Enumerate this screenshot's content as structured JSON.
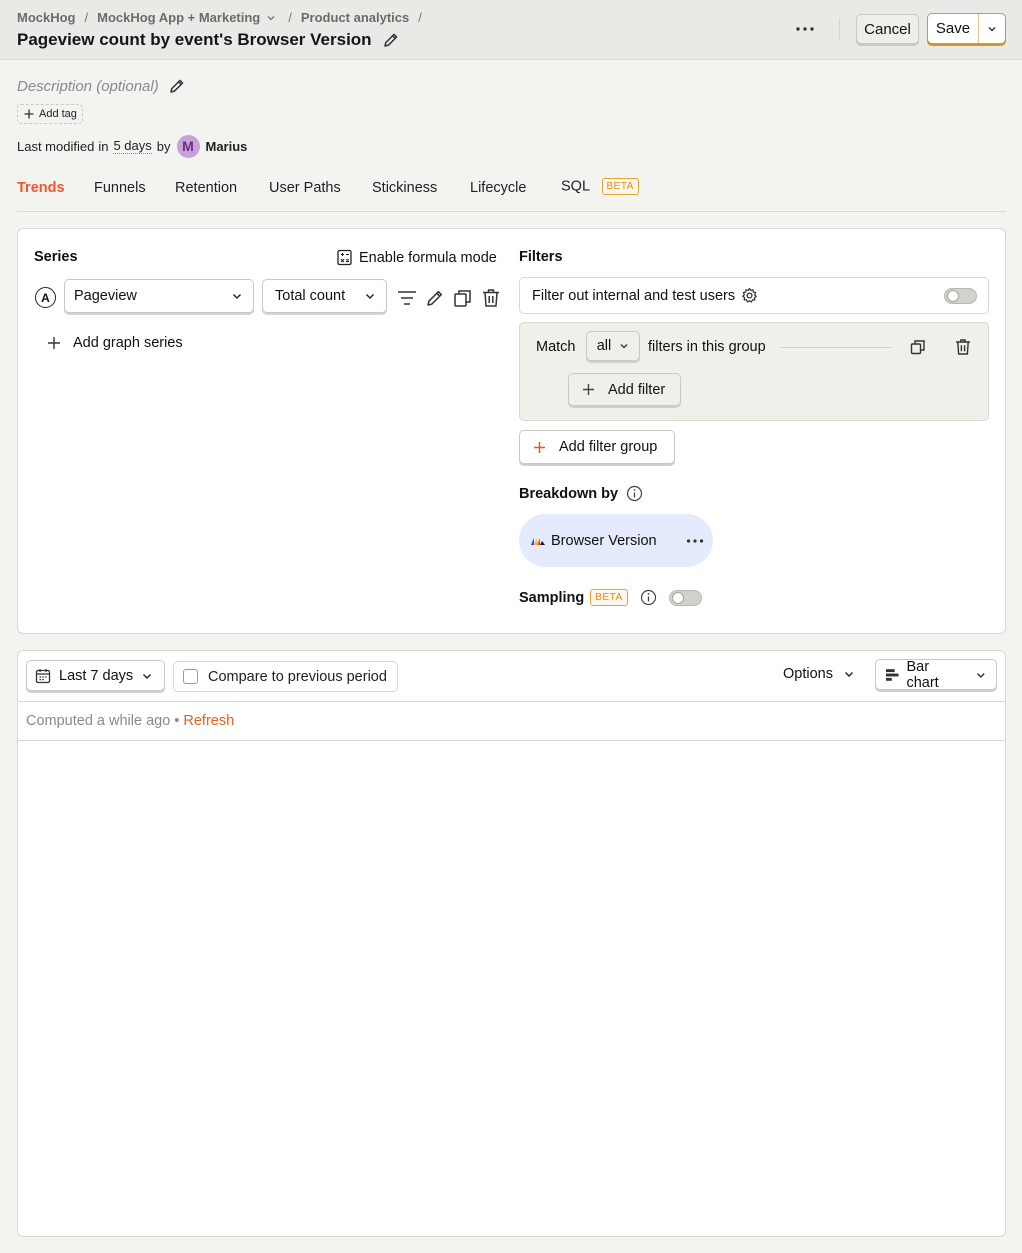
{
  "breadcrumbs": [
    {
      "label": "MockHog"
    },
    {
      "label": "MockHog App + Marketing",
      "has_dropdown": true
    },
    {
      "label": "Product analytics"
    }
  ],
  "breadcrumb_separator": "/",
  "insight": {
    "title": "Pageview count by event's Browser Version",
    "description_placeholder": "Description (optional)",
    "add_tag_label": "Add tag",
    "last_modified": {
      "prefix": "Last modified",
      "in_word": "in",
      "when": "5 days",
      "by_word": "by",
      "avatar_initial": "M",
      "user": "Marius"
    }
  },
  "header_actions": {
    "cancel_label": "Cancel",
    "save_label": "Save"
  },
  "tabs": [
    {
      "label": "Trends",
      "active": true
    },
    {
      "label": "Funnels"
    },
    {
      "label": "Retention"
    },
    {
      "label": "User Paths"
    },
    {
      "label": "Stickiness"
    },
    {
      "label": "Lifecycle"
    },
    {
      "label": "SQL",
      "badge": "BETA"
    }
  ],
  "series": {
    "title": "Series",
    "formula_mode_label": "Enable formula mode",
    "items": [
      {
        "letter": "A",
        "event": "Pageview",
        "math": "Total count"
      }
    ],
    "add_series_label": "Add graph series"
  },
  "filters": {
    "title": "Filters",
    "test_users_label": "Filter out internal and test users",
    "test_users_enabled": false,
    "group": {
      "match_label": "Match",
      "match_value": "all",
      "suffix_label": "filters in this group",
      "add_filter_label": "Add filter"
    },
    "add_group_label": "Add filter group"
  },
  "breakdown": {
    "title": "Breakdown by",
    "property": "Browser Version"
  },
  "sampling": {
    "title": "Sampling",
    "badge": "BETA",
    "enabled": false
  },
  "results": {
    "date_range": "Last 7 days",
    "compare_label": "Compare to previous period",
    "compare_checked": false,
    "options_label": "Options",
    "chart_type": "Bar chart",
    "computed_label": "Computed a while ago",
    "status_separator": "•",
    "refresh_label": "Refresh"
  },
  "colors": {
    "accent_active_tab": "#f2552c",
    "save_border": "#d5962c",
    "beta_badge": "#e08a16",
    "refresh_link": "#e2621f",
    "breakdown_pill": "#e6eafd"
  }
}
